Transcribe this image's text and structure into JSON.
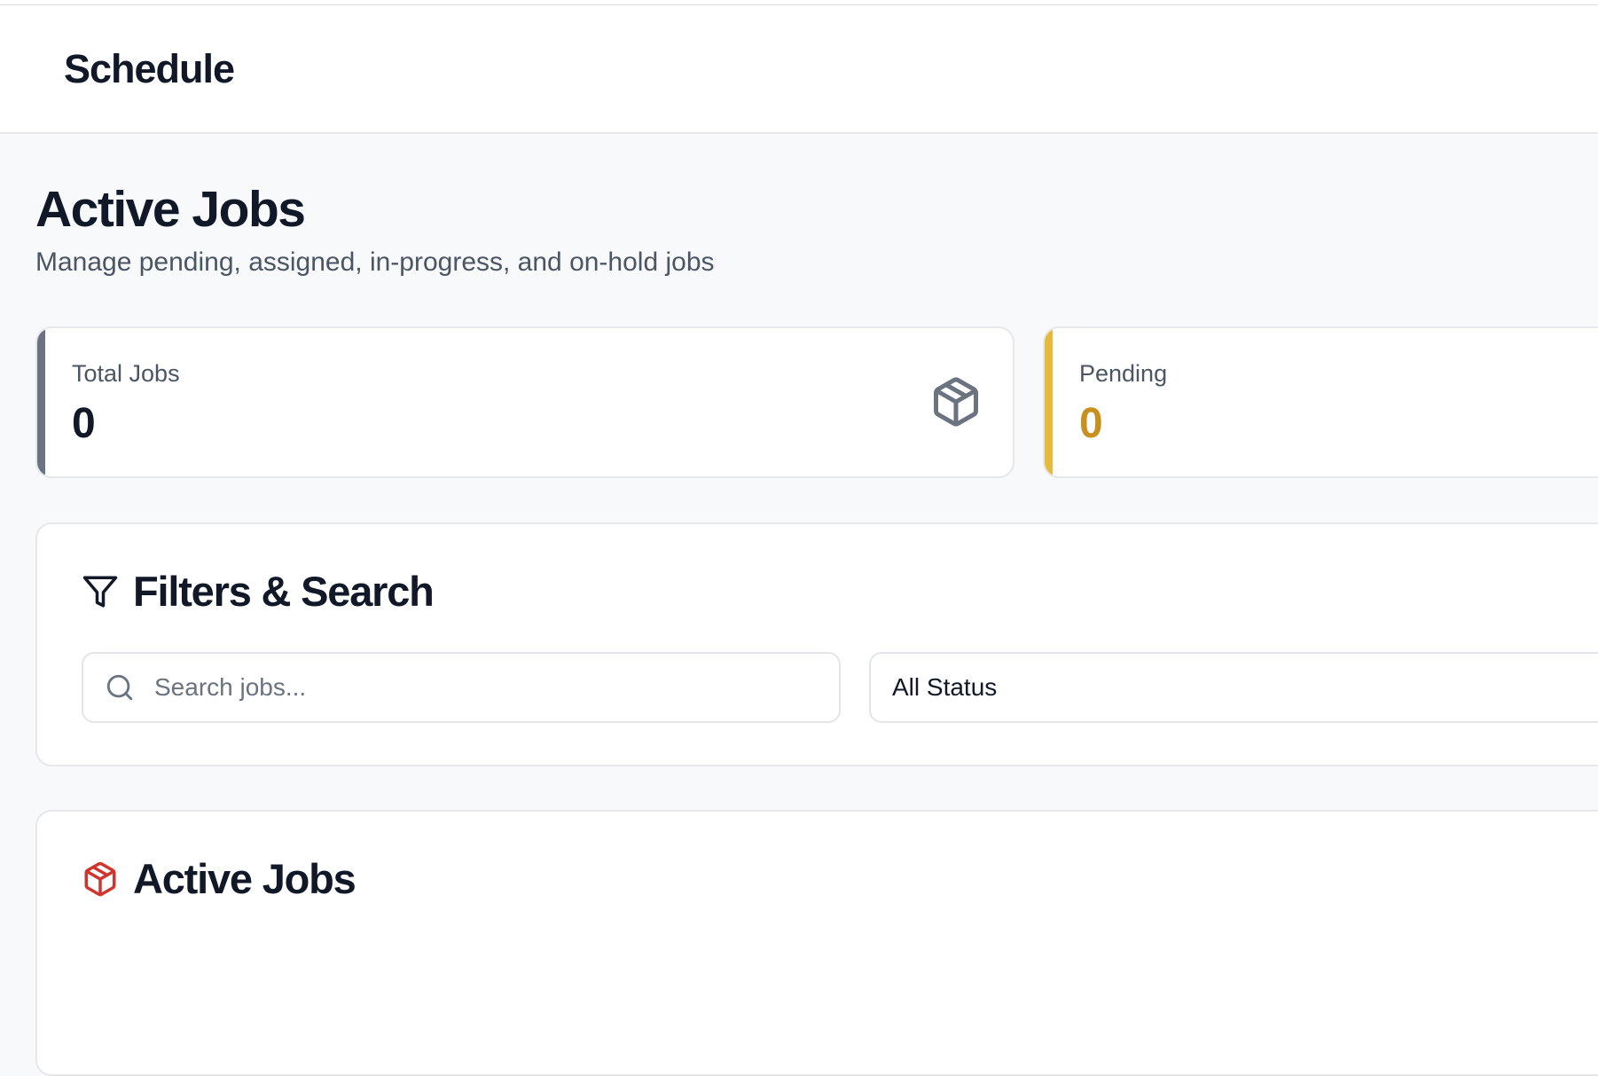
{
  "header": {
    "title": "Schedule"
  },
  "page": {
    "title": "Active Jobs",
    "subtitle": "Manage pending, assigned, in-progress, and on-hold jobs"
  },
  "stats": [
    {
      "label": "Total Jobs",
      "value": "0",
      "icon": "package-icon",
      "accent_color": "#6b7280",
      "value_color": "#111827"
    },
    {
      "label": "Pending",
      "value": "0",
      "accent_color": "#e5b93a",
      "value_color": "#c8901f"
    }
  ],
  "filters": {
    "heading": "Filters & Search",
    "icon": "filter-icon",
    "search": {
      "placeholder": "Search jobs...",
      "value": "",
      "icon": "search-icon"
    },
    "status": {
      "selected": "All Status",
      "icon": "chevron-down-icon"
    }
  },
  "jobs_panel": {
    "heading": "Active Jobs",
    "icon": "package-icon",
    "icon_color": "#d0342c"
  }
}
